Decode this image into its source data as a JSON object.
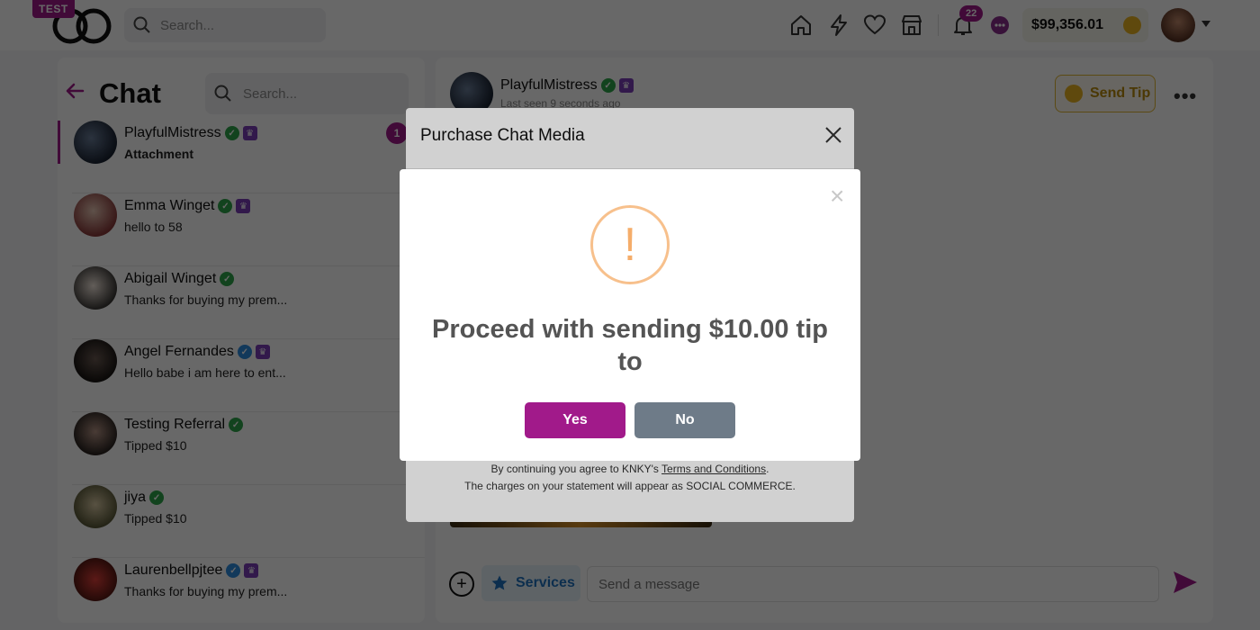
{
  "header": {
    "test_badge": "TEST",
    "search_placeholder": "Search...",
    "notification_count": "22",
    "wallet_balance": "$99,356.01",
    "nav_icons": [
      "home-icon",
      "lightning-icon",
      "heart-icon",
      "store-icon",
      "bell-icon",
      "chat-bubble-icon"
    ]
  },
  "chat_list": {
    "title": "Chat",
    "search_placeholder": "Search...",
    "conversations": [
      {
        "name": "PlayfulMistress",
        "message": "Attachment",
        "verified": "green",
        "crown": true,
        "unread": "1",
        "active": true
      },
      {
        "name": "Emma Winget",
        "message": "hello to 58",
        "verified": "green",
        "crown": true
      },
      {
        "name": "Abigail Winget",
        "message": "Thanks for buying my prem...",
        "verified": "green",
        "crown": false
      },
      {
        "name": "Angel Fernandes",
        "message": "Hello babe i am here to ent...",
        "verified": "blue",
        "crown": true
      },
      {
        "name": "Testing Referral",
        "message": "Tipped $10",
        "verified": "green",
        "crown": false
      },
      {
        "name": "jiya",
        "message": "Tipped $10",
        "verified": "green",
        "crown": false
      },
      {
        "name": "Laurenbellpjtee",
        "message": "Thanks for buying my prem...",
        "verified": "blue",
        "crown": true
      }
    ]
  },
  "conversation": {
    "name": "PlayfulMistress",
    "last_seen": "Last seen 9 seconds ago",
    "send_tip_label": "Send Tip",
    "services_label": "Services",
    "message_placeholder": "Send a message"
  },
  "purchase_modal": {
    "title": "Purchase Chat Media",
    "terms_prefix": "By continuing you agree to KNKY's ",
    "terms_link": "Terms and Conditions",
    "terms_suffix": ".",
    "statement_note": "The charges on your statement will appear as SOCIAL COMMERCE."
  },
  "confirm_dialog": {
    "icon_glyph": "!",
    "message": "Proceed with sending $10.00 tip to",
    "yes_label": "Yes",
    "no_label": "No",
    "close_glyph": "×"
  },
  "colors": {
    "brand": "#a11a8a",
    "warning": "#f5ad6a",
    "no_button": "#6e7b88",
    "tip_gold": "#e9b320"
  }
}
